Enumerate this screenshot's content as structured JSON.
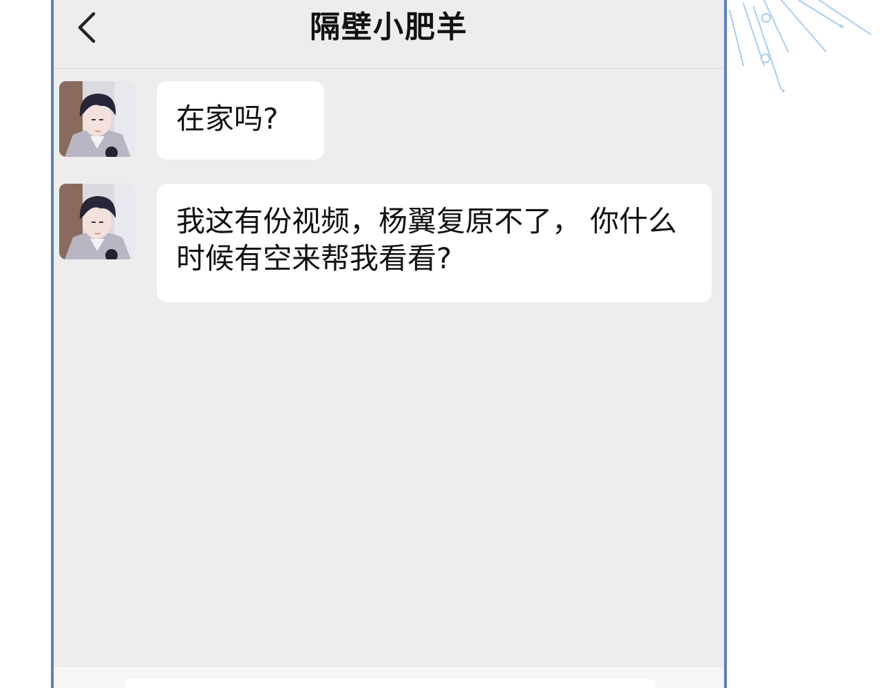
{
  "chat": {
    "title": "隔壁小肥羊",
    "back_icon": "chevron-left-icon"
  },
  "messages": [
    {
      "sender": "contact",
      "text": "在家吗?"
    },
    {
      "sender": "contact",
      "text": "我这有份视频，杨翼复原不了， 你什么时候有空来帮我看看?"
    }
  ],
  "colors": {
    "frame_border": "#5a7ec4",
    "chat_background": "#ededed",
    "bubble_background": "#ffffff",
    "sparkle": "#a9cdf0"
  }
}
